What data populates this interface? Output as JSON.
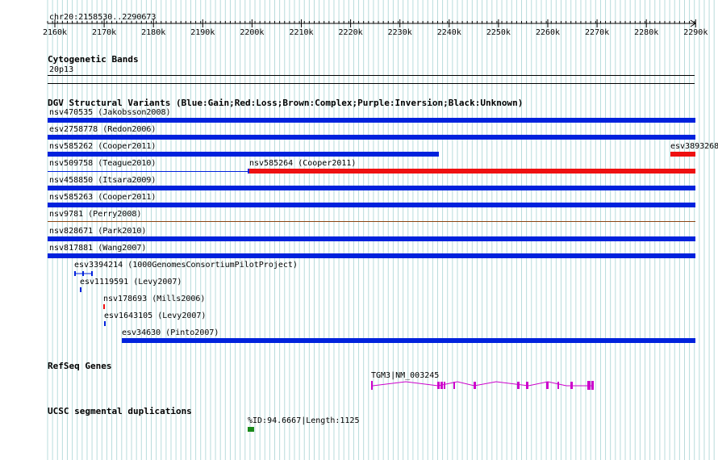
{
  "region": "chr20:2158530..2290673",
  "ruler": {
    "ticks": [
      "2160k",
      "2170k",
      "2180k",
      "2190k",
      "2200k",
      "2210k",
      "2220k",
      "2230k",
      "2240k",
      "2250k",
      "2260k",
      "2270k",
      "2280k",
      "2290k"
    ]
  },
  "tracks": {
    "cytobands": {
      "title": "Cytogenetic Bands",
      "band": "20p13"
    },
    "dgv": {
      "title": "DGV Structural Variants (Blue:Gain;Red:Loss;Brown:Complex;Purple:Inversion;Black:Unknown)",
      "features": [
        {
          "name": "nsv470535 (Jakobsson2008)",
          "type": "gain"
        },
        {
          "name": "esv2758778 (Redon2006)",
          "type": "gain"
        },
        {
          "name": "nsv585262 (Cooper2011)",
          "type": "gain"
        },
        {
          "name": "esv3893268",
          "type": "loss"
        },
        {
          "name": "nsv509758 (Teague2010)",
          "type": "gain"
        },
        {
          "name": "nsv585264 (Cooper2011)",
          "type": "loss"
        },
        {
          "name": "nsv458850 (Itsara2009)",
          "type": "gain"
        },
        {
          "name": "nsv585263 (Cooper2011)",
          "type": "gain"
        },
        {
          "name": "nsv9781 (Perry2008)",
          "type": "complex"
        },
        {
          "name": "nsv828671 (Park2010)",
          "type": "gain"
        },
        {
          "name": "nsv817881 (Wang2007)",
          "type": "gain"
        },
        {
          "name": "esv3394214 (1000GenomesConsortiumPilotProject)",
          "type": "gain"
        },
        {
          "name": "esv1119591 (Levy2007)",
          "type": "gain"
        },
        {
          "name": "nsv178693 (Mills2006)",
          "type": "loss"
        },
        {
          "name": "esv1643105 (Levy2007)",
          "type": "gain"
        },
        {
          "name": "esv34630 (Pinto2007)",
          "type": "gain"
        }
      ]
    },
    "refseq": {
      "title": "RefSeq Genes",
      "gene": "TGM3|NM_003245"
    },
    "segdups": {
      "title": "UCSC segmental duplications",
      "feature": "%ID:94.6667|Length:1125"
    }
  },
  "colors": {
    "gain": "#0022dd",
    "loss": "#ee1111",
    "complex": "#8b4513",
    "gene": "#cc00cc",
    "segdup": "#1a8a1a",
    "grid": "#b8dcdc"
  }
}
